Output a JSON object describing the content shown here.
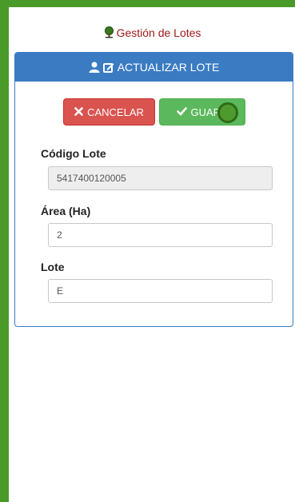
{
  "header": {
    "title": "Gestión de Lotes",
    "icon": "tree-icon"
  },
  "card": {
    "title": "ACTUALIZAR LOTE",
    "icons": [
      "user-icon",
      "edit-icon"
    ]
  },
  "buttons": {
    "cancel_label": "CANCELAR",
    "save_label": "GUARD"
  },
  "fields": {
    "codigo": {
      "label": "Código Lote",
      "value": "5417400120005"
    },
    "area": {
      "label": "Área (Ha)",
      "value": "2"
    },
    "lote": {
      "label": "Lote",
      "value": "E"
    }
  },
  "colors": {
    "frame": "#4a9a2a",
    "header_title": "#a01a1a",
    "card_header": "#3a7bc2",
    "cancel": "#d9534f",
    "save": "#5cb85c"
  }
}
